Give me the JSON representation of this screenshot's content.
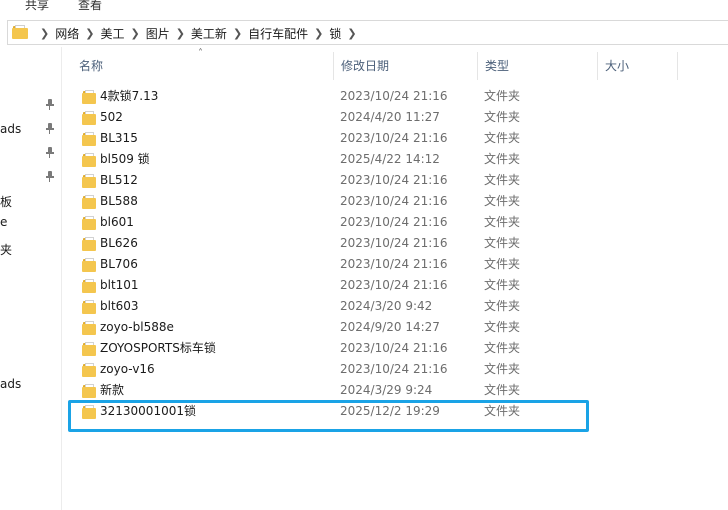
{
  "ribbon": {
    "tabs": [
      "共享",
      "查看"
    ]
  },
  "address": {
    "icon": "folder-icon",
    "crumbs": [
      "网络",
      "美工",
      "图片",
      "美工新",
      "自行车配件",
      "锁"
    ]
  },
  "nav": {
    "labels": [
      "ads",
      "板",
      "e",
      "夹",
      "ads"
    ]
  },
  "columns": {
    "name": "名称",
    "date": "修改日期",
    "type": "类型",
    "size": "大小"
  },
  "files": [
    {
      "name": "4款锁7.13",
      "date": "2023/10/24 21:16",
      "type": "文件夹"
    },
    {
      "name": "502",
      "date": "2024/4/20 11:27",
      "type": "文件夹"
    },
    {
      "name": "BL315",
      "date": "2023/10/24 21:16",
      "type": "文件夹"
    },
    {
      "name": "bl509 锁",
      "date": "2025/4/22 14:12",
      "type": "文件夹"
    },
    {
      "name": "BL512",
      "date": "2023/10/24 21:16",
      "type": "文件夹"
    },
    {
      "name": "BL588",
      "date": "2023/10/24 21:16",
      "type": "文件夹"
    },
    {
      "name": "bl601",
      "date": "2023/10/24 21:16",
      "type": "文件夹"
    },
    {
      "name": "BL626",
      "date": "2023/10/24 21:16",
      "type": "文件夹"
    },
    {
      "name": "BL706",
      "date": "2023/10/24 21:16",
      "type": "文件夹"
    },
    {
      "name": "blt101",
      "date": "2023/10/24 21:16",
      "type": "文件夹"
    },
    {
      "name": "blt603",
      "date": "2024/3/20 9:42",
      "type": "文件夹"
    },
    {
      "name": "zoyo-bl588e",
      "date": "2024/9/20 14:27",
      "type": "文件夹"
    },
    {
      "name": "ZOYOSPORTS标车锁",
      "date": "2023/10/24 21:16",
      "type": "文件夹"
    },
    {
      "name": "zoyo-v16",
      "date": "2023/10/24 21:16",
      "type": "文件夹"
    },
    {
      "name": "新款",
      "date": "2024/3/29 9:24",
      "type": "文件夹"
    },
    {
      "name": "32130001001锁",
      "date": "2025/12/2 19:29",
      "type": "文件夹"
    }
  ],
  "colors": {
    "highlight": "#1aa3e6",
    "folder": "#f4c64e",
    "header_text": "#4c607a"
  }
}
